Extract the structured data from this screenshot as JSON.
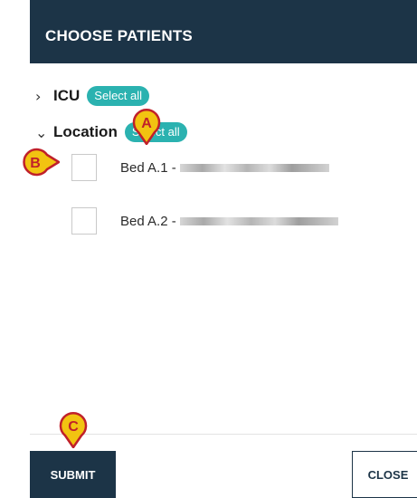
{
  "dialog": {
    "title": "CHOOSE PATIENTS"
  },
  "groups": [
    {
      "label": "ICU",
      "expanded": false,
      "select_all_label": "Select all"
    },
    {
      "label": "Location",
      "expanded": true,
      "select_all_label": "Select all",
      "beds": [
        {
          "label": "Bed A.1 -",
          "checked": false
        },
        {
          "label": "Bed A.2 -",
          "checked": false
        }
      ]
    }
  ],
  "footer": {
    "submit_label": "SUBMIT",
    "close_label": "CLOSE"
  },
  "annotations": {
    "marker_a": "A",
    "marker_b": "B",
    "marker_c": "C"
  },
  "colors": {
    "header_bg": "#1c3447",
    "select_all_bg": "#2bb2b0",
    "marker_fill": "#f2c311",
    "marker_stroke": "#c0202a"
  }
}
